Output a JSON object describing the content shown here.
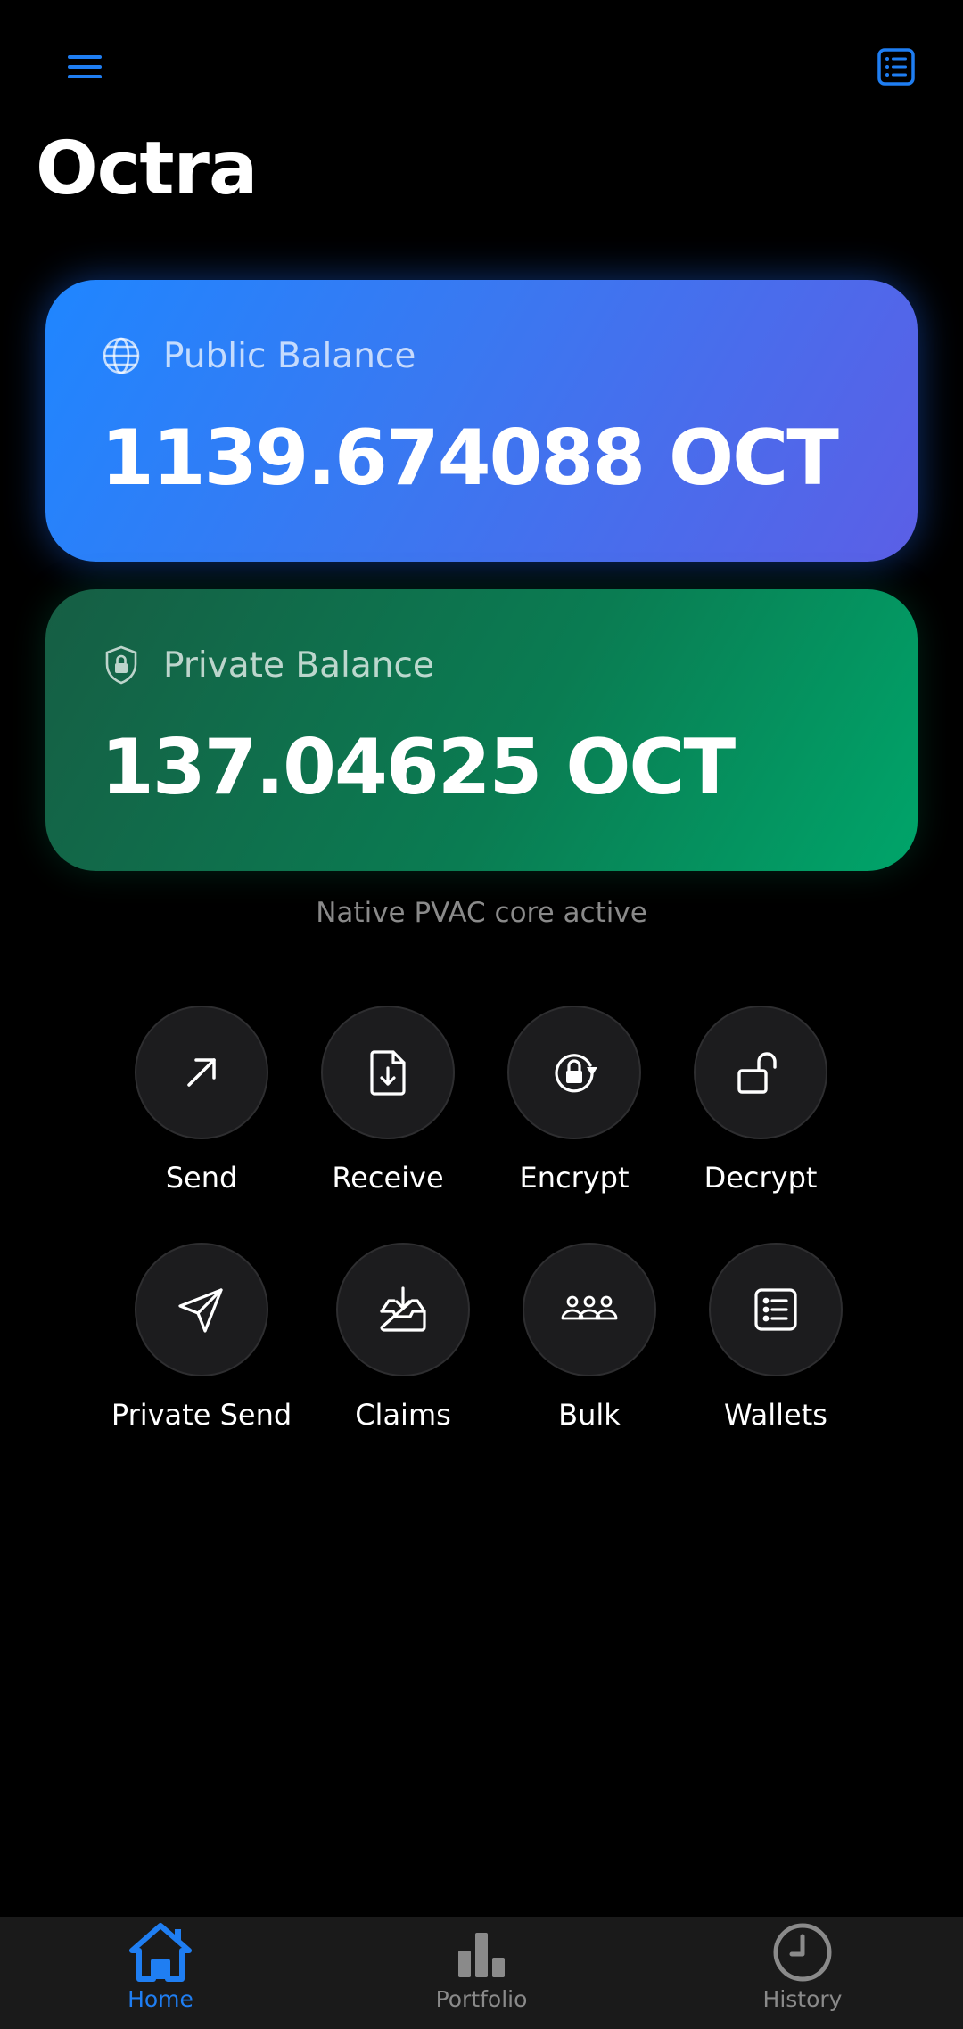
{
  "app": {
    "title": "Octra"
  },
  "balances": {
    "public": {
      "label": "Public Balance",
      "value": "1139.674088 OCT"
    },
    "private": {
      "label": "Private Balance",
      "value": "137.04625 OCT"
    }
  },
  "status": {
    "text": "Native PVAC core active"
  },
  "actions": [
    {
      "label": "Send",
      "icon": "arrow-up-right-icon"
    },
    {
      "label": "Receive",
      "icon": "file-download-icon"
    },
    {
      "label": "Encrypt",
      "icon": "lock-rotate-icon"
    },
    {
      "label": "Decrypt",
      "icon": "unlock-icon"
    },
    {
      "label": "Private Send",
      "icon": "paper-plane-icon"
    },
    {
      "label": "Claims",
      "icon": "inbox-download-icon"
    },
    {
      "label": "Bulk",
      "icon": "users-group-icon"
    },
    {
      "label": "Wallets",
      "icon": "list-icon"
    }
  ],
  "nav": [
    {
      "label": "Home",
      "icon": "home-icon",
      "active": true
    },
    {
      "label": "Portfolio",
      "icon": "bar-chart-icon",
      "active": false
    },
    {
      "label": "History",
      "icon": "clock-icon",
      "active": false
    }
  ],
  "colors": {
    "accent": "#1f7ef2",
    "public_card": "#1f86ff",
    "private_card": "#0a7c52",
    "inactive": "#8a8a8a"
  }
}
